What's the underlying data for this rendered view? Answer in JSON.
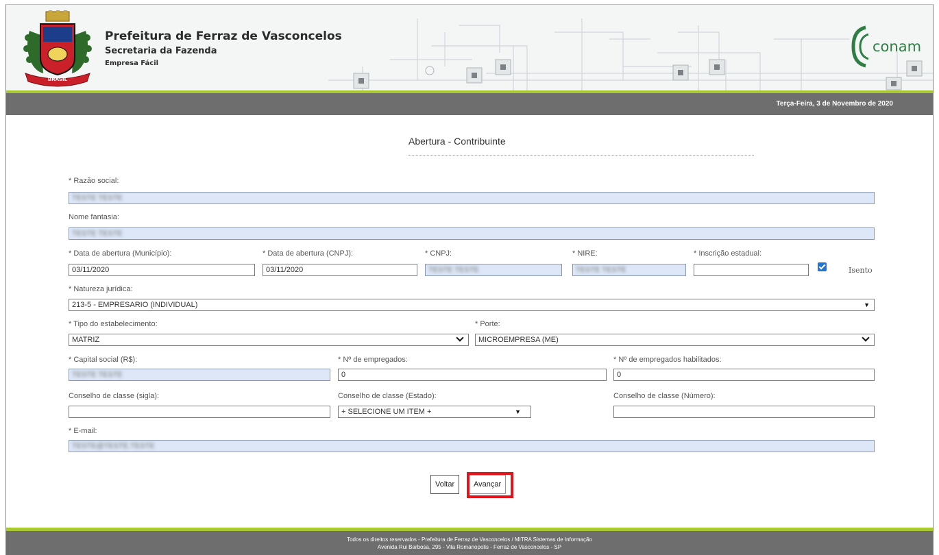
{
  "header": {
    "title": "Prefeitura de Ferraz de Vasconcelos",
    "subtitle": "Secretaria da Fazenda",
    "module": "Empresa Fácil",
    "crest_text": "BRASIL",
    "logo_text": "conam",
    "date": "Terça-Feira, 3 de Novembro de 2020"
  },
  "form": {
    "title": "Abertura - Contribuinte",
    "razao_social": {
      "label": "* Razão social:",
      "value": "TESTE TESTE"
    },
    "nome_fantasia": {
      "label": "Nome fantasia:",
      "value": "TESTE TESTE"
    },
    "data_abertura_municipio": {
      "label": "* Data de abertura (Município):",
      "value": "03/11/2020"
    },
    "data_abertura_cnpj": {
      "label": "* Data de abertura (CNPJ):",
      "value": "03/11/2020"
    },
    "cnpj": {
      "label": "* CNPJ:",
      "value": "TESTE TESTE"
    },
    "nire": {
      "label": "* NIRE:",
      "value": "TESTE TESTE"
    },
    "inscricao_estadual": {
      "label": "* Inscrição estadual:",
      "value": ""
    },
    "isento": {
      "label": "Isento",
      "checked": true
    },
    "natureza_juridica": {
      "label": "* Natureza jurídica:",
      "value": "213-5 - EMPRESARIO (INDIVIDUAL)"
    },
    "tipo_estabelecimento": {
      "label": "* Tipo do estabelecimento:",
      "value": "MATRIZ"
    },
    "porte": {
      "label": "* Porte:",
      "value": "MICROEMPRESA (ME)"
    },
    "capital_social": {
      "label": "* Capital social (R$):",
      "value": "TESTE TESTE"
    },
    "num_empregados": {
      "label": "* Nº de empregados:",
      "value": "0"
    },
    "num_empregados_habilitados": {
      "label": "* Nº de empregados habilitados:",
      "value": "0"
    },
    "conselho_sigla": {
      "label": "Conselho de classe (sigla):",
      "value": ""
    },
    "conselho_estado": {
      "label": "Conselho de classe (Estado):",
      "value": "+ SELECIONE UM ITEM +"
    },
    "conselho_numero": {
      "label": "Conselho de classe (Número):",
      "value": ""
    },
    "email": {
      "label": "* E-mail:",
      "value": "TESTE@TESTE.TESTE"
    },
    "back_label": "Voltar",
    "next_label": "Avançar"
  },
  "footer": {
    "line1": "Todos os direitos reservados - Prefeitura de Ferraz de Vasconcelos / MITRA Sistemas de Informação",
    "line2": "Avenida Rui Barbosa, 295 - Vila Romanopolis - Ferraz de Vasconcelos - SP"
  },
  "colors": {
    "accent_green": "#a9c833",
    "bar_gray": "#6e6e6e",
    "readonly_fill": "#dde7f7",
    "highlight_red": "#e0161c",
    "conam_green": "#2f7d43"
  }
}
